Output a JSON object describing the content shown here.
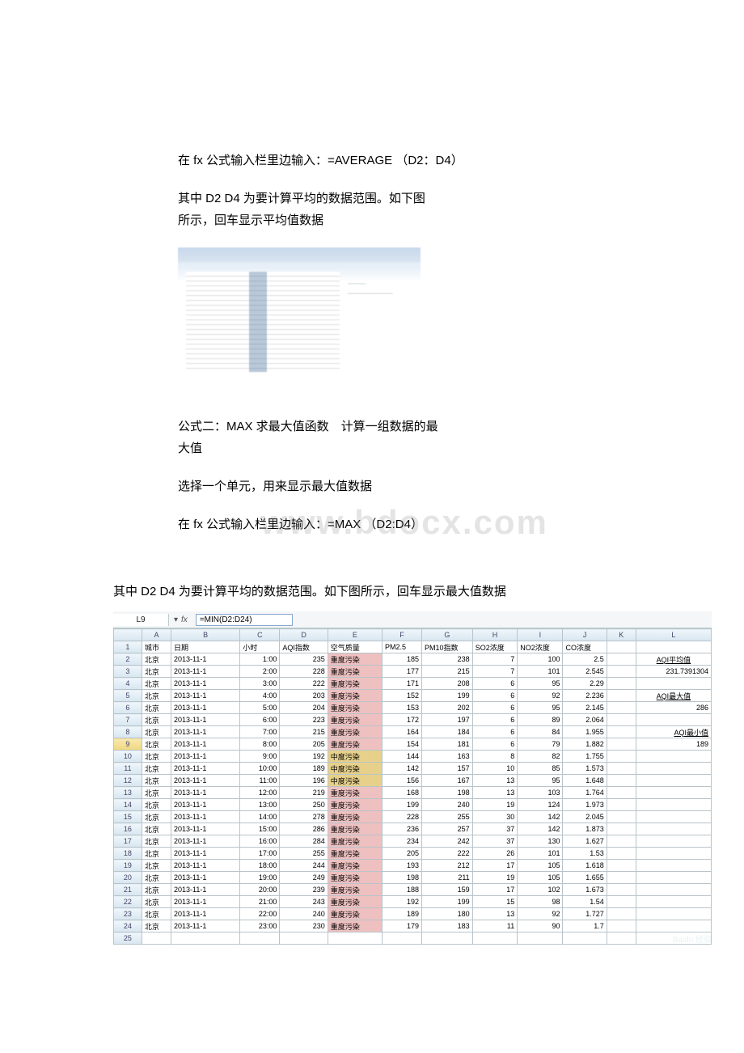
{
  "text": {
    "p1": "在 fx 公式输入栏里边输入：=AVERAGE （D2：D4）",
    "p2a": "其中 D2 D4 为要计算平均的数据范围。如下图",
    "p2b": "所示，回车显示平均值数据",
    "p3a": "公式二：MAX 求最大值函数　计算一组数据的最",
    "p3b": "大值",
    "p4": "选择一个单元，用来显示最大值数据",
    "p5": "在 fx 公式输入栏里边输入：=MAX （D2:D4）",
    "watermark": "www.bdocx.com",
    "p6": "其中 D2 D4 为要计算平均的数据范围。如下图所示，回车显示最大值数据"
  },
  "sheet": {
    "namebox": "L9",
    "fx_arrow": "▾",
    "fx_label": "fx",
    "formula": "=MIN(D2:D24)",
    "cols": [
      "",
      "A",
      "B",
      "C",
      "D",
      "E",
      "F",
      "G",
      "H",
      "I",
      "J",
      "K",
      "L"
    ],
    "headers": [
      "城市",
      "日期",
      "小时",
      "AQI指数",
      "空气质量",
      "PM2.5",
      "PM10指数",
      "SO2浓度",
      "NO2浓度",
      "CO浓度"
    ],
    "side": {
      "avg_label": "AQI平均值",
      "avg_value": "231.7391304",
      "max_label": "AQI最大值",
      "max_value": "286",
      "min_label": "AQI最小值",
      "min_value": "189"
    },
    "rows": [
      {
        "r": 2,
        "city": "北京",
        "date": "2013-11-1",
        "hr": "1:00",
        "aqi": 235,
        "q": "重度污染",
        "qc": "heavy",
        "pm25": 185,
        "pm10": 238,
        "so2": 7,
        "no2": 100,
        "co": "2.5"
      },
      {
        "r": 3,
        "city": "北京",
        "date": "2013-11-1",
        "hr": "2:00",
        "aqi": 228,
        "q": "重度污染",
        "qc": "heavy",
        "pm25": 177,
        "pm10": 215,
        "so2": 7,
        "no2": 101,
        "co": "2.545"
      },
      {
        "r": 4,
        "city": "北京",
        "date": "2013-11-1",
        "hr": "3:00",
        "aqi": 222,
        "q": "重度污染",
        "qc": "heavy",
        "pm25": 171,
        "pm10": 208,
        "so2": 6,
        "no2": 95,
        "co": "2.29"
      },
      {
        "r": 5,
        "city": "北京",
        "date": "2013-11-1",
        "hr": "4:00",
        "aqi": 203,
        "q": "重度污染",
        "qc": "heavy",
        "pm25": 152,
        "pm10": 199,
        "so2": 6,
        "no2": 92,
        "co": "2.236"
      },
      {
        "r": 6,
        "city": "北京",
        "date": "2013-11-1",
        "hr": "5:00",
        "aqi": 204,
        "q": "重度污染",
        "qc": "heavy",
        "pm25": 153,
        "pm10": 202,
        "so2": 6,
        "no2": 95,
        "co": "2.145"
      },
      {
        "r": 7,
        "city": "北京",
        "date": "2013-11-1",
        "hr": "6:00",
        "aqi": 223,
        "q": "重度污染",
        "qc": "heavy",
        "pm25": 172,
        "pm10": 197,
        "so2": 6,
        "no2": 89,
        "co": "2.064"
      },
      {
        "r": 8,
        "city": "北京",
        "date": "2013-11-1",
        "hr": "7:00",
        "aqi": 215,
        "q": "重度污染",
        "qc": "heavy",
        "pm25": 164,
        "pm10": 184,
        "so2": 6,
        "no2": 84,
        "co": "1.955"
      },
      {
        "r": 9,
        "city": "北京",
        "date": "2013-11-1",
        "hr": "8:00",
        "aqi": 205,
        "q": "重度污染",
        "qc": "heavy",
        "pm25": 154,
        "pm10": 181,
        "so2": 6,
        "no2": 79,
        "co": "1.882",
        "sel": true
      },
      {
        "r": 10,
        "city": "北京",
        "date": "2013-11-1",
        "hr": "9:00",
        "aqi": 192,
        "q": "中度污染",
        "qc": "medium",
        "pm25": 144,
        "pm10": 163,
        "so2": 8,
        "no2": 82,
        "co": "1.755"
      },
      {
        "r": 11,
        "city": "北京",
        "date": "2013-11-1",
        "hr": "10:00",
        "aqi": 189,
        "q": "中度污染",
        "qc": "medium",
        "pm25": 142,
        "pm10": 157,
        "so2": 10,
        "no2": 85,
        "co": "1.573"
      },
      {
        "r": 12,
        "city": "北京",
        "date": "2013-11-1",
        "hr": "11:00",
        "aqi": 196,
        "q": "中度污染",
        "qc": "medium",
        "pm25": 156,
        "pm10": 167,
        "so2": 13,
        "no2": 95,
        "co": "1.648"
      },
      {
        "r": 13,
        "city": "北京",
        "date": "2013-11-1",
        "hr": "12:00",
        "aqi": 219,
        "q": "重度污染",
        "qc": "heavy",
        "pm25": 168,
        "pm10": 198,
        "so2": 13,
        "no2": 103,
        "co": "1.764"
      },
      {
        "r": 14,
        "city": "北京",
        "date": "2013-11-1",
        "hr": "13:00",
        "aqi": 250,
        "q": "重度污染",
        "qc": "heavy",
        "pm25": 199,
        "pm10": 240,
        "so2": 19,
        "no2": 124,
        "co": "1.973"
      },
      {
        "r": 15,
        "city": "北京",
        "date": "2013-11-1",
        "hr": "14:00",
        "aqi": 278,
        "q": "重度污染",
        "qc": "heavy",
        "pm25": 228,
        "pm10": 255,
        "so2": 30,
        "no2": 142,
        "co": "2.045"
      },
      {
        "r": 16,
        "city": "北京",
        "date": "2013-11-1",
        "hr": "15:00",
        "aqi": 286,
        "q": "重度污染",
        "qc": "heavy",
        "pm25": 236,
        "pm10": 257,
        "so2": 37,
        "no2": 142,
        "co": "1.873"
      },
      {
        "r": 17,
        "city": "北京",
        "date": "2013-11-1",
        "hr": "16:00",
        "aqi": 284,
        "q": "重度污染",
        "qc": "heavy",
        "pm25": 234,
        "pm10": 242,
        "so2": 37,
        "no2": 130,
        "co": "1.627"
      },
      {
        "r": 18,
        "city": "北京",
        "date": "2013-11-1",
        "hr": "17:00",
        "aqi": 255,
        "q": "重度污染",
        "qc": "heavy",
        "pm25": 205,
        "pm10": 222,
        "so2": 26,
        "no2": 101,
        "co": "1.53"
      },
      {
        "r": 19,
        "city": "北京",
        "date": "2013-11-1",
        "hr": "18:00",
        "aqi": 244,
        "q": "重度污染",
        "qc": "heavy",
        "pm25": 193,
        "pm10": 212,
        "so2": 17,
        "no2": 105,
        "co": "1.618"
      },
      {
        "r": 20,
        "city": "北京",
        "date": "2013-11-1",
        "hr": "19:00",
        "aqi": 249,
        "q": "重度污染",
        "qc": "heavy",
        "pm25": 198,
        "pm10": 211,
        "so2": 19,
        "no2": 105,
        "co": "1.655"
      },
      {
        "r": 21,
        "city": "北京",
        "date": "2013-11-1",
        "hr": "20:00",
        "aqi": 239,
        "q": "重度污染",
        "qc": "heavy",
        "pm25": 188,
        "pm10": 159,
        "so2": 17,
        "no2": 102,
        "co": "1.673"
      },
      {
        "r": 22,
        "city": "北京",
        "date": "2013-11-1",
        "hr": "21:00",
        "aqi": 243,
        "q": "重度污染",
        "qc": "heavy",
        "pm25": 192,
        "pm10": 199,
        "so2": 15,
        "no2": 98,
        "co": "1.54"
      },
      {
        "r": 23,
        "city": "北京",
        "date": "2013-11-1",
        "hr": "22:00",
        "aqi": 240,
        "q": "重度污染",
        "qc": "heavy",
        "pm25": 189,
        "pm10": 180,
        "so2": 13,
        "no2": 92,
        "co": "1.727"
      },
      {
        "r": 24,
        "city": "北京",
        "date": "2013-11-1",
        "hr": "23:00",
        "aqi": 230,
        "q": "重度污染",
        "qc": "heavy",
        "pm25": 179,
        "pm10": 183,
        "so2": 11,
        "no2": 90,
        "co": "1.7"
      }
    ]
  }
}
